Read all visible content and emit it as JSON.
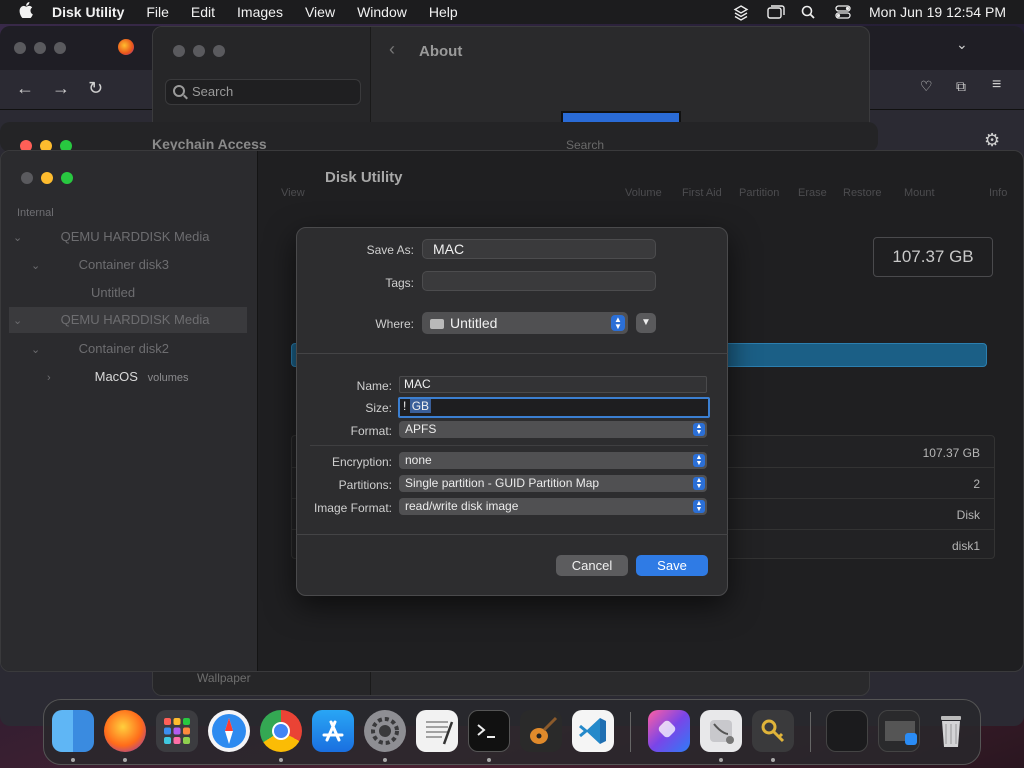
{
  "menubar": {
    "apple": "",
    "app_name": "Disk Utility",
    "items": [
      "File",
      "Edit",
      "Images",
      "View",
      "Window",
      "Help"
    ],
    "clock": "Mon Jun 19  12:54 PM"
  },
  "settings": {
    "search_placeholder": "Search",
    "title": "About",
    "sidebar_bottom_item": "Wallpaper"
  },
  "keychain": {
    "title": "Keychain Access",
    "search": "Search"
  },
  "disk_utility": {
    "title": "Disk Utility",
    "toolbar": {
      "view": "View",
      "volume": "Volume",
      "first_aid": "First Aid",
      "partition": "Partition",
      "erase": "Erase",
      "restore": "Restore",
      "mount": "Mount",
      "info": "Info"
    },
    "sidebar": {
      "section": "Internal",
      "items": [
        {
          "label": "QEMU HARDDISK Media"
        },
        {
          "label": "Container disk3"
        },
        {
          "label": "Untitled"
        },
        {
          "label": "QEMU HARDDISK Media"
        },
        {
          "label": "Container disk2"
        },
        {
          "label": "MacOS",
          "sub": "volumes"
        }
      ]
    },
    "capacity": "107.37 GB",
    "info_values": [
      "107.37 GB",
      "2",
      "Disk",
      "disk1"
    ]
  },
  "save_sheet": {
    "save_as_label": "Save As:",
    "save_as_value": "MAC",
    "tags_label": "Tags:",
    "where_label": "Where:",
    "where_value": "Untitled",
    "name_label": "Name:",
    "name_value": "MAC",
    "size_label": "Size:",
    "size_value_cursor": "!",
    "size_value": "GB",
    "format_label": "Format:",
    "format_value": "APFS",
    "encryption_label": "Encryption:",
    "encryption_value": "none",
    "partitions_label": "Partitions:",
    "partitions_value": "Single partition - GUID Partition Map",
    "image_format_label": "Image Format:",
    "image_format_value": "read/write disk image",
    "cancel": "Cancel",
    "save": "Save"
  },
  "dock": {
    "apps": [
      "Finder",
      "Firefox",
      "Launchpad",
      "Safari",
      "Chrome",
      "App Store",
      "System Settings",
      "TextEdit",
      "Terminal",
      "GarageBand",
      "Visual Studio Code",
      "Shortcuts",
      "Disk Utility",
      "Keychain Access",
      "Screenshot",
      "App Store Window",
      "Trash"
    ]
  }
}
